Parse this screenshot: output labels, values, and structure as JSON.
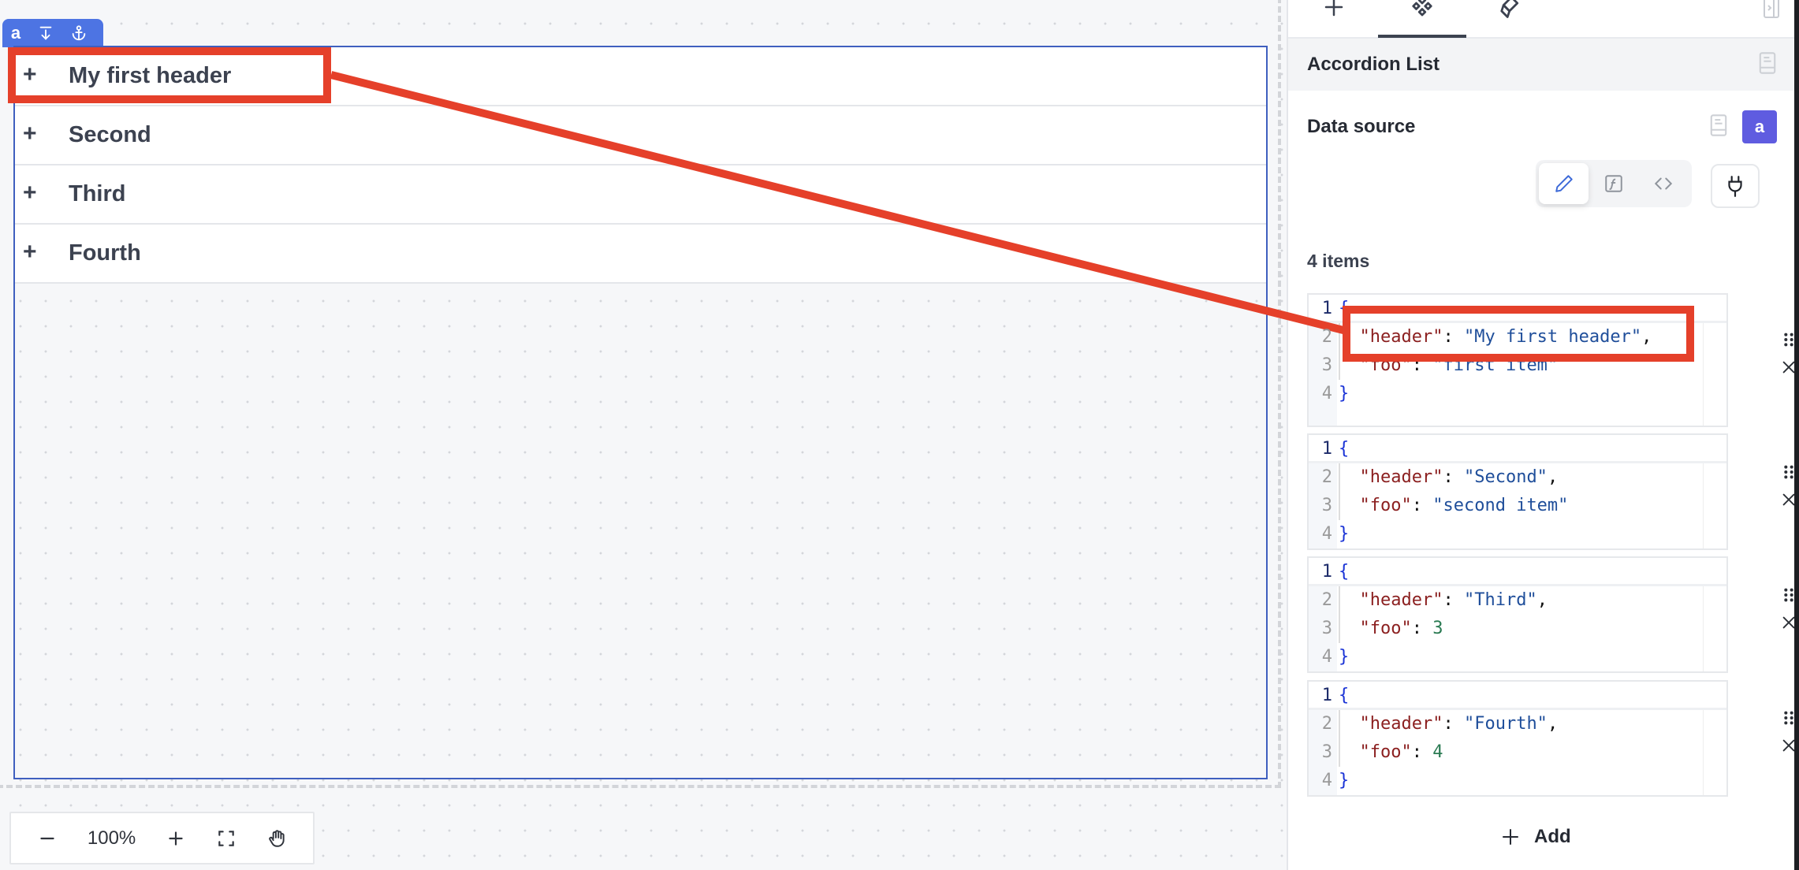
{
  "canvas": {
    "selection_tab": {
      "label": "a",
      "icons": [
        "align-bottom-icon",
        "anchor-icon"
      ]
    },
    "accordion": {
      "expand_symbol": "+",
      "items": [
        {
          "header": "My first header"
        },
        {
          "header": "Second"
        },
        {
          "header": "Third"
        },
        {
          "header": "Fourth"
        }
      ]
    },
    "zoom_bar": {
      "zoom_out_icon": "minus-icon",
      "zoom_level": "100%",
      "zoom_in_icon": "plus-icon",
      "fit_icon": "fullscreen-icon",
      "pan_icon": "hand-icon"
    }
  },
  "panel": {
    "tabs": [
      {
        "icon": "plus-icon",
        "active": false
      },
      {
        "icon": "components-icon",
        "active": true
      },
      {
        "icon": "paint-bucket-icon",
        "active": false
      }
    ],
    "component_title": "Accordion List",
    "data_source": {
      "label": "Data source",
      "badge": "a",
      "modes": [
        {
          "icon": "pencil-icon",
          "active": true
        },
        {
          "icon": "function-icon",
          "active": false
        },
        {
          "icon": "code-icon",
          "active": false
        }
      ],
      "connect_icon": "plug-icon"
    },
    "items_count": "4 items",
    "items": [
      {
        "line_numbers": [
          "1",
          "2",
          "3",
          "4"
        ],
        "header": "My first header",
        "foo": "\"first item\"",
        "foo_type": "string"
      },
      {
        "line_numbers": [
          "1",
          "2",
          "3",
          "4"
        ],
        "header": "Second",
        "foo": "\"second item\"",
        "foo_type": "string"
      },
      {
        "line_numbers": [
          "1",
          "2",
          "3",
          "4"
        ],
        "header": "Third",
        "foo": "3",
        "foo_type": "number"
      },
      {
        "line_numbers": [
          "1",
          "2",
          "3",
          "4"
        ],
        "header": "Fourth",
        "foo": "4",
        "foo_type": "number"
      }
    ],
    "json_keys": {
      "header": "\"header\"",
      "foo": "\"foo\""
    },
    "add_label": "Add"
  },
  "annotation": {
    "color": "#e5402a",
    "from": "accordion header 'My first header'",
    "to": "editor line '\"header\": \"My first header\",'"
  },
  "colors": {
    "accent_blue": "#4d74e3",
    "badge_purple": "#5f5ce0",
    "selection_border": "#3f5fbf"
  }
}
